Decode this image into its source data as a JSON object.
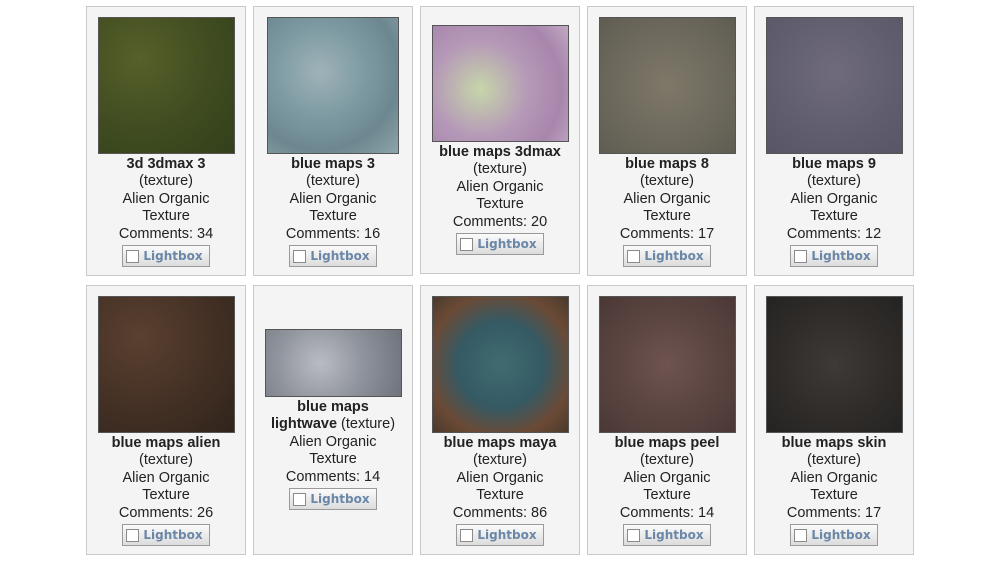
{
  "cards": [
    {
      "title": "3d 3dmax 3",
      "type": "(texture)",
      "cat1": "Alien Organic",
      "cat2": "Texture",
      "comments": "Comments: 34",
      "lightbox": "Lightbox",
      "texture": "green-fabric"
    },
    {
      "title": "blue maps 3",
      "type": "(texture)",
      "cat1": "Alien Organic",
      "cat2": "Texture",
      "comments": "Comments: 16",
      "lightbox": "Lightbox",
      "texture": "blue-rock"
    },
    {
      "title": "blue maps 3dmax",
      "type": "(texture)",
      "cat1": "Alien Organic",
      "cat2": "Texture",
      "comments": "Comments: 20",
      "lightbox": "Lightbox",
      "texture": "pink-green-marble"
    },
    {
      "title": "blue maps 8",
      "type": "(texture)",
      "cat1": "Alien Organic",
      "cat2": "Texture",
      "comments": "Comments: 17",
      "lightbox": "Lightbox",
      "texture": "grey-leather"
    },
    {
      "title": "blue maps 9",
      "type": "(texture)",
      "cat1": "Alien Organic",
      "cat2": "Texture",
      "comments": "Comments: 12",
      "lightbox": "Lightbox",
      "texture": "purple-grey"
    },
    {
      "title": "blue maps alien",
      "type": "(texture)",
      "cat1": "Alien Organic",
      "cat2": "Texture",
      "comments": "Comments: 26",
      "lightbox": "Lightbox",
      "texture": "brown-cells"
    },
    {
      "title": "blue maps",
      "title2": "lightwave",
      "type": "(texture)",
      "cat1": "Alien Organic",
      "cat2": "Texture",
      "comments": "Comments: 14",
      "lightbox": "Lightbox",
      "texture": "grey-granite"
    },
    {
      "title": "blue maps maya",
      "type": "(texture)",
      "cat1": "Alien Organic",
      "cat2": "Texture",
      "comments": "Comments: 86",
      "lightbox": "Lightbox",
      "texture": "teal-cells"
    },
    {
      "title": "blue maps peel",
      "type": "(texture)",
      "cat1": "Alien Organic",
      "cat2": "Texture",
      "comments": "Comments: 14",
      "lightbox": "Lightbox",
      "texture": "reddish-bark"
    },
    {
      "title": "blue maps skin",
      "type": "(texture)",
      "cat1": "Alien Organic",
      "cat2": "Texture",
      "comments": "Comments: 17",
      "lightbox": "Lightbox",
      "texture": "dark-skin"
    }
  ]
}
